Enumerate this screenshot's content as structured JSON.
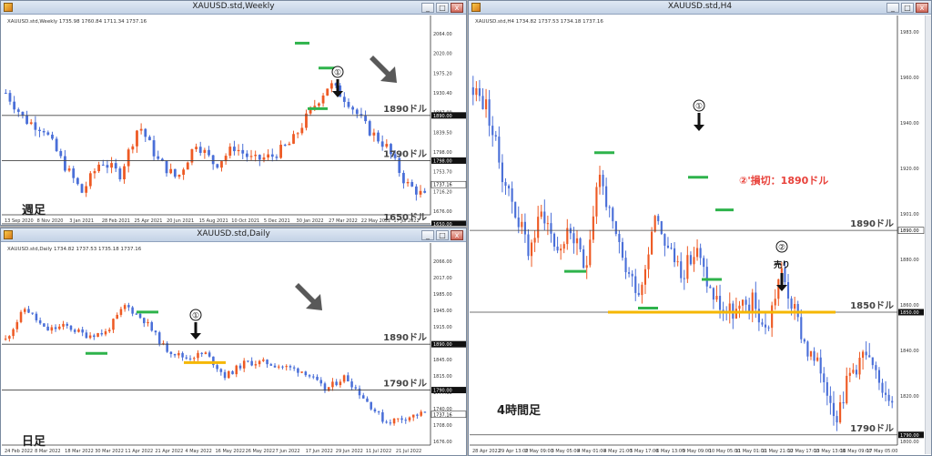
{
  "windows": [
    {
      "id": "weekly",
      "title": "XAUUSD.std,Weekly",
      "info": "XAUUSD.std,Weekly  1735.98 1760.84 1711.34 1737.16",
      "timeframe_label": "週足",
      "price_ticks": [
        "2064.00",
        "2020.00",
        "1975.20",
        "1930.40",
        "1887.00",
        "1839.50",
        "1798.00",
        "1753.70",
        "1716.20",
        "1676.00"
      ],
      "current_price": "1737.16",
      "level_tags": [
        "1890.00",
        "1798.00",
        "1650.00"
      ],
      "date_ticks": [
        "13 Sep 2020",
        "8 Nov 2020",
        "3 Jan 2021",
        "28 Feb 2021",
        "25 Apr 2021",
        "20 Jun 2021",
        "15 Aug 2021",
        "10 Oct 2021",
        "5 Dec 2021",
        "30 Jan 2022",
        "27 Mar 2022",
        "22 May 2022",
        "17 Jul 2022"
      ],
      "levels": [
        {
          "label": "1890ドル",
          "price": 1890
        },
        {
          "label": "1790ドル",
          "price": 1790
        },
        {
          "label": "1650ドル",
          "price": 1650
        }
      ],
      "marker_number": "①",
      "arrow_direction": "down-right"
    },
    {
      "id": "daily",
      "title": "XAUUSD.std,Daily",
      "info": "XAUUSD.std,Daily  1734.82 1737.53 1735.18 1737.16",
      "timeframe_label": "日足",
      "price_ticks": [
        "2066.00",
        "2017.00",
        "1985.00",
        "1945.00",
        "1915.00",
        "1880.00",
        "1845.00",
        "1815.00",
        "1777.00",
        "1740.00",
        "1708.00",
        "1676.00"
      ],
      "current_price": "1737.16",
      "level_tags": [
        "1890.00",
        "1790.00"
      ],
      "date_ticks": [
        "24 Feb 2022",
        "8 Mar 2022",
        "18 Mar 2022",
        "30 Mar 2022",
        "11 Apr 2022",
        "21 Apr 2022",
        "4 May 2022",
        "16 May 2022",
        "26 May 2022",
        "7 Jun 2022",
        "17 Jun 2022",
        "29 Jun 2022",
        "11 Jul 2022",
        "21 Jul 2022"
      ],
      "levels": [
        {
          "label": "1890ドル",
          "price": 1890
        },
        {
          "label": "1790ドル",
          "price": 1790
        }
      ],
      "marker_number": "①",
      "arrow_direction": "down-right"
    },
    {
      "id": "h4",
      "title": "XAUUSD.std,H4",
      "info": "XAUUSD.std,H4  1734.82 1737.53 1734.18 1737.16",
      "timeframe_label": "4時間足",
      "price_ticks": [
        "1983.00",
        "1960.00",
        "1940.00",
        "1920.00",
        "1901.00",
        "1880.00",
        "1860.00",
        "1840.00",
        "1820.00",
        "1800.00"
      ],
      "current_price": "1890.00",
      "level_tags": [
        "1890.00",
        "1850.00",
        "1790.00"
      ],
      "date_ticks": [
        "28 Apr 2022",
        "29 Apr 13:00",
        "2 May 09:00",
        "3 May 05:00",
        "4 May 01:00",
        "4 May 21:00",
        "5 May 17:00",
        "6 May 13:00",
        "9 May 09:00",
        "10 May 05:00",
        "11 May 01:00",
        "11 May 21:00",
        "12 May 17:00",
        "13 May 13:00",
        "16 May 09:00",
        "17 May 05:00"
      ],
      "levels": [
        {
          "label": "1890ドル",
          "price": 1890
        },
        {
          "label": "1850ドル",
          "price": 1850
        },
        {
          "label": "1790ドル",
          "price": 1790
        }
      ],
      "marker_number": "①",
      "marker2_number": "②",
      "sell_label": "売り",
      "stop_label": "②'損切：1890ドル"
    }
  ],
  "colors": {
    "bull": "#ee5a24",
    "bear": "#4a6fd8",
    "support": "#2eb34b",
    "zone": "#f5b700",
    "stop_text": "#e8413a",
    "level_line": "#444444",
    "arrow_gray": "#595959"
  },
  "window_buttons": {
    "minimize": "_",
    "maximize": "□",
    "close": "x"
  }
}
